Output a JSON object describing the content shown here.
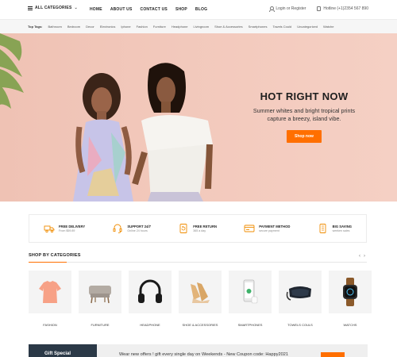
{
  "header": {
    "categories_label": "ALL CATEGORIES",
    "nav": [
      "HOME",
      "ABOUT US",
      "CONTACT US",
      "SHOP",
      "BLOG"
    ],
    "login_label": "Login or Register",
    "hotline_label": "Hotline (+1)2354 567 890"
  },
  "top_tags": {
    "label": "Top Tags:",
    "tags": [
      "Bathroom",
      "Bedroom",
      "Decor",
      "Electronics",
      "Iphone",
      "Fashion",
      "Furniture",
      "Headphone",
      "Livingroom",
      "Shoe & Accessories",
      "Smartphones",
      "Towels Could",
      "Uncategorized",
      "Watche"
    ]
  },
  "hero": {
    "title": "HOT RIGHT NOW",
    "subtitle_line1": "Summer whites and bright tropical prints",
    "subtitle_line2": "capture a breezy, island vibe.",
    "button": "Shop now"
  },
  "features": [
    {
      "title": "FREE DELIVERY",
      "sub": "From $59.89",
      "icon": "truck-icon"
    },
    {
      "title": "SUPPORT 24/7",
      "sub": "Online 24 hours",
      "icon": "headset-icon"
    },
    {
      "title": "FREE RETURN",
      "sub": "365 a day",
      "icon": "return-icon"
    },
    {
      "title": "PAYMENT METHOD",
      "sub": "secure payment",
      "icon": "card-icon"
    },
    {
      "title": "BIG SAVING",
      "sub": "weeken sales",
      "icon": "coins-icon"
    }
  ],
  "categories_section": {
    "title": "SHOP BY CATEGORIES",
    "prev": "‹",
    "next": "›",
    "items": [
      {
        "name": "FASHION",
        "icon": "blouse-icon"
      },
      {
        "name": "FURNITURE",
        "icon": "chair-icon"
      },
      {
        "name": "HEADPHONE",
        "icon": "headphone-icon"
      },
      {
        "name": "SHOE & ACCESSORIES",
        "icon": "shoe-icon"
      },
      {
        "name": "SMARTPHONES",
        "icon": "smartphone-icon"
      },
      {
        "name": "TOWELS COULS",
        "icon": "vr-headset-icon"
      },
      {
        "name": "WATCHS",
        "icon": "watch-icon"
      }
    ]
  },
  "banner": {
    "gift_label": "Gift Special",
    "promo_text": "Wear new offers ! gift every single day on Weekends - New Coupon code: Happy2021"
  },
  "colors": {
    "accent": "#ff6f00",
    "hero_bg": "#f2c8bb",
    "banner_dark": "#2b3947"
  }
}
